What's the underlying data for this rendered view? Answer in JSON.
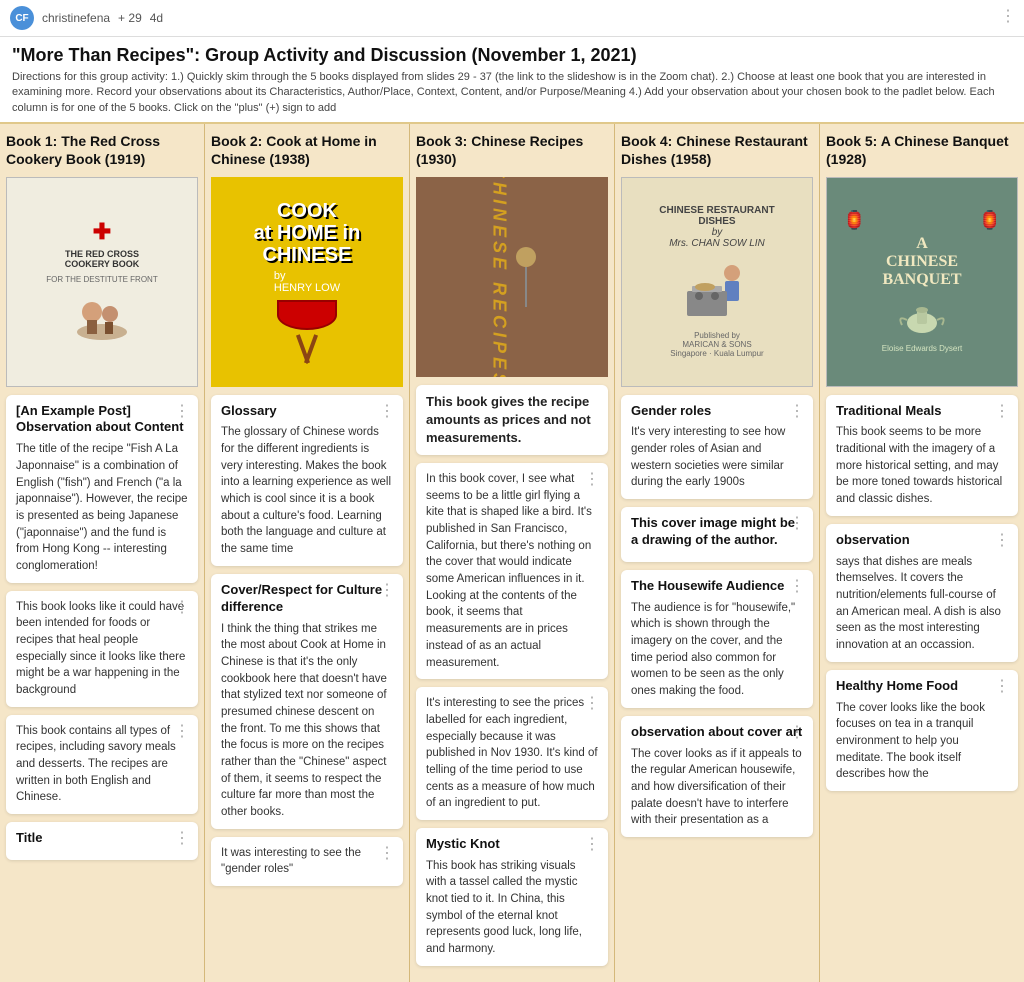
{
  "topbar": {
    "user": "christinefena",
    "points": "+ 29",
    "time": "4d"
  },
  "header": {
    "title": "\"More Than Recipes\": Group Activity and Discussion (November 1, 2021)",
    "description": "Directions for this group activity: 1.) Quickly skim through the 5 books displayed from slides 29 - 37 (the link to the slideshow is in the Zoom chat). 2.) Choose at least one book that you are interested in examining more. Record your observations about its Characteristics, Author/Place, Context, Content, and/or Purpose/Meaning 4.) Add your observation about your chosen book to the padlet below. Each column is for one of the 5 books. Click on the \"plus\" (+) sign to add"
  },
  "columns": [
    {
      "id": "col1",
      "title": "Book 1: The Red Cross Cookery Book (1919)",
      "cards": [
        {
          "id": "example-post",
          "title": "[An Example Post] Observation about Content",
          "body": "The title of the recipe \"Fish A La Japonnaise\" is a combination of English (\"fish\") and French (\"a la japonnaise\"). However, the recipe is presented as being Japanese (\"japonnaise\") and the fund is from Hong Kong -- interesting conglomeration!"
        },
        {
          "id": "war-background",
          "title": "",
          "body": "This book looks like it could have been intended for foods or recipes that heal people especially since it looks like there might be a war happening in the background"
        },
        {
          "id": "all-recipes",
          "title": "",
          "body": "This book contains all types of recipes, including savory meals and desserts. The recipes are written in both English and Chinese."
        },
        {
          "id": "title-card",
          "title": "Title",
          "body": ""
        }
      ]
    },
    {
      "id": "col2",
      "title": "Book 2: Cook at Home in Chinese (1938)",
      "cards": [
        {
          "id": "glossary",
          "title": "Glossary",
          "body": "The glossary of Chinese words for the different ingredients is very interesting. Makes the book into a learning experience as well which is cool since it is a book about a culture's food. Learning both the language and culture at the same time"
        },
        {
          "id": "cover-respect",
          "title": "Cover/Respect for Culture difference",
          "body": "I think the thing that strikes me the most about Cook at Home in Chinese is that it's the only cookbook here that doesn't have that stylized text nor someone of presumed chinese descent on the front. To me this shows that the focus is more on the recipes rather than the \"Chinese\" aspect of them, it seems to respect the culture far more than most the other books."
        },
        {
          "id": "gender-roles-note",
          "title": "",
          "body": "It was interesting to see the \"gender roles\""
        }
      ]
    },
    {
      "id": "col3",
      "title": "Book 3: Chinese Recipes (1930)",
      "cards": [
        {
          "id": "prices-note",
          "title": "This book gives the recipe amounts as prices and not measurements.",
          "body": "",
          "highlighted": true
        },
        {
          "id": "girl-kite",
          "title": "",
          "body": "In this book cover, I see what seems to be a little girl flying a kite that is shaped like a bird. It's published in San Francisco, California, but there's nothing on the cover that would indicate some American influences in it. Looking at the contents of the book, it seems that measurements are in prices instead of as an actual measurement."
        },
        {
          "id": "prices-label",
          "title": "",
          "body": "It's interesting to see the prices labelled for each ingredient, especially because it was published in Nov 1930. It's kind of telling of the time period to use cents as a measure of how much of an ingredient to put."
        },
        {
          "id": "mystic-knot",
          "title": "Mystic Knot",
          "body": "This book has striking visuals with a tassel called the mystic knot tied to it. In China, this symbol of the eternal knot represents good luck, long life, and harmony."
        }
      ]
    },
    {
      "id": "col4",
      "title": "Book 4: Chinese Restaurant Dishes (1958)",
      "cards": [
        {
          "id": "gender-roles",
          "title": "Gender roles",
          "body": "It's very interesting to see how gender roles of Asian and western societies were similar during the early 1900s"
        },
        {
          "id": "cover-drawing",
          "title": "This cover image might be a drawing of the author.",
          "body": ""
        },
        {
          "id": "housewife",
          "title": "The Housewife Audience",
          "body": "The audience is for \"housewife,\" which is shown through the imagery on the cover, and the time period also common for women to be seen as the only ones making the food."
        },
        {
          "id": "cover-art",
          "title": "observation about cover art",
          "body": "The cover looks as if it appeals to the regular American housewife, and how diversification of their palate doesn't have to interfere with their presentation as a"
        }
      ]
    },
    {
      "id": "col5",
      "title": "Book 5: A Chinese Banquet (1928)",
      "cards": [
        {
          "id": "traditional-meals",
          "title": "Traditional Meals",
          "body": "This book seems to be more traditional with the imagery of a more historical setting, and may be more toned towards historical and classic dishes."
        },
        {
          "id": "observation",
          "title": "observation",
          "body": "says that dishes are meals themselves. It covers the nutrition/elements full-course of an American meal. A dish is also seen as the most interesting innovation at an occassion."
        },
        {
          "id": "healthy-home-food",
          "title": "Healthy Home Food",
          "body": "The cover looks like the book focuses on tea in a tranquil environment to help you meditate. The book itself describes how the"
        }
      ]
    }
  ]
}
